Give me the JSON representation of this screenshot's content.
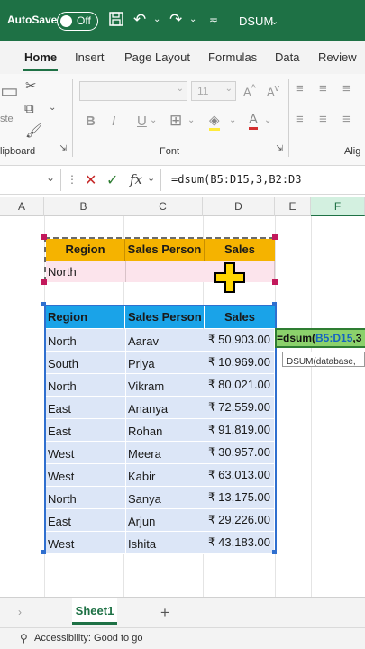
{
  "titlebar": {
    "autosave_label": "AutoSave",
    "toggle_state": "Off",
    "filename": "DSUM",
    "bg_color": "#1e7145"
  },
  "tabs": [
    "Home",
    "Insert",
    "Page Layout",
    "Formulas",
    "Data",
    "Review"
  ],
  "ribbon": {
    "group_clipboard": "lipboard",
    "group_font": "Font",
    "group_alignment": "Alig",
    "paste_label": "ste",
    "font_size": "11",
    "bold": "B",
    "italic": "I",
    "underline": "U",
    "font_color_glyph": "A"
  },
  "formula_bar": {
    "fx_label": "fx",
    "formula": "=dsum(B5:D15,3,B2:D3"
  },
  "columns": [
    "A",
    "B",
    "C",
    "D",
    "E",
    "F"
  ],
  "criteria": {
    "headers": [
      "Region",
      "Sales Person",
      "Sales"
    ],
    "region_value": "North"
  },
  "database": {
    "headers": [
      "Region",
      "Sales Person",
      "Sales"
    ],
    "currency": "₹",
    "rows": [
      {
        "region": "North",
        "person": "Aarav",
        "sales": "50,903.00"
      },
      {
        "region": "South",
        "person": "Priya",
        "sales": "10,969.00"
      },
      {
        "region": "North",
        "person": "Vikram",
        "sales": "80,021.00"
      },
      {
        "region": "East",
        "person": "Ananya",
        "sales": "72,559.00"
      },
      {
        "region": "East",
        "person": "Rohan",
        "sales": "91,819.00"
      },
      {
        "region": "West",
        "person": "Meera",
        "sales": "30,957.00"
      },
      {
        "region": "West",
        "person": "Kabir",
        "sales": "63,013.00"
      },
      {
        "region": "North",
        "person": "Sanya",
        "sales": "13,175.00"
      },
      {
        "region": "East",
        "person": "Arjun",
        "sales": "29,226.00"
      },
      {
        "region": "West",
        "person": "Ishita",
        "sales": "43,183.00"
      }
    ]
  },
  "edit_cell": {
    "prefix": "=dsum(",
    "range": "B5:D15",
    "suffix": ",3",
    "tooltip": "DSUM(database,"
  },
  "sheet_tab": "Sheet1",
  "add_sheet": "+",
  "status": "Accessibility: Good to go",
  "colors": {
    "criteria_header": "#f5b300",
    "database_header": "#1aa3e8",
    "database_row": "#dce6f7",
    "criteria_row": "#fce4ec"
  }
}
